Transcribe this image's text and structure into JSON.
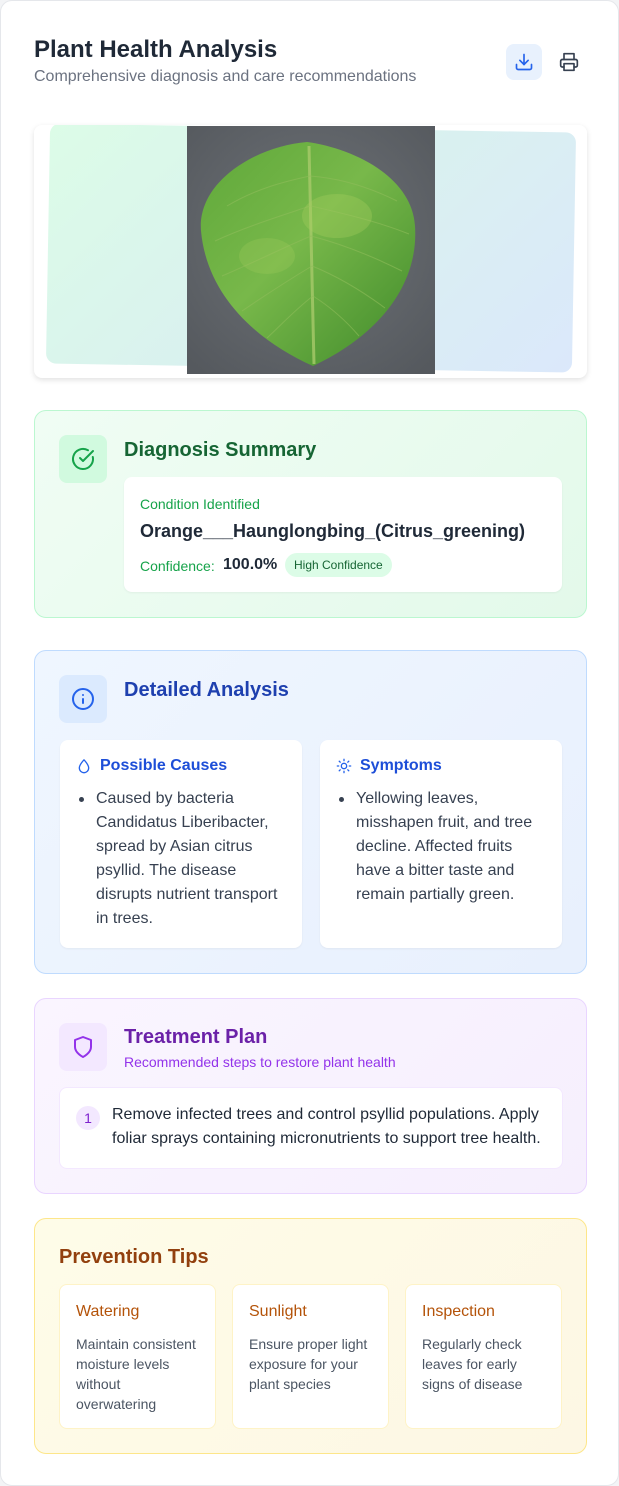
{
  "header": {
    "title": "Plant Health Analysis",
    "subtitle": "Comprehensive diagnosis and care recommendations",
    "actions": [
      {
        "icon": "download-icon",
        "color": "#2563eb"
      },
      {
        "icon": "printer-icon",
        "color": "#374151"
      }
    ]
  },
  "image": {
    "subject": "citrus leaf photo"
  },
  "diagnosis": {
    "title": "Diagnosis Summary",
    "condition_label": "Condition Identified",
    "condition": "Orange___Haunglongbing_(Citrus_greening)",
    "confidence_label": "Confidence:",
    "confidence_value": "100.0%",
    "confidence_badge": "High Confidence",
    "accent": "#166534"
  },
  "analysis": {
    "title": "Detailed Analysis",
    "causes": {
      "title": "Possible Causes",
      "icon": "droplet-icon",
      "items": [
        "Caused by bacteria Candidatus Liberibacter, spread by Asian citrus psyllid. The disease disrupts nutrient transport in trees."
      ]
    },
    "symptoms": {
      "title": "Symptoms",
      "icon": "sun-icon",
      "items": [
        "Yellowing leaves, misshapen fruit, and tree decline. Affected fruits have a bitter taste and remain partially green."
      ]
    },
    "accent": "#1e40af"
  },
  "treatment": {
    "title": "Treatment Plan",
    "subtitle": "Recommended steps to restore plant health",
    "steps": [
      {
        "number": "1",
        "text": "Remove infected trees and control psyllid populations. Apply foliar sprays containing micronutrients to support tree health."
      }
    ],
    "accent": "#6b21a8"
  },
  "prevention": {
    "title": "Prevention Tips",
    "tips": [
      {
        "title": "Watering",
        "description": "Maintain consistent moisture levels without overwatering"
      },
      {
        "title": "Sunlight",
        "description": "Ensure proper light exposure for your plant species"
      },
      {
        "title": "Inspection",
        "description": "Regularly check leaves for early signs of disease"
      }
    ],
    "accent": "#92400e"
  }
}
